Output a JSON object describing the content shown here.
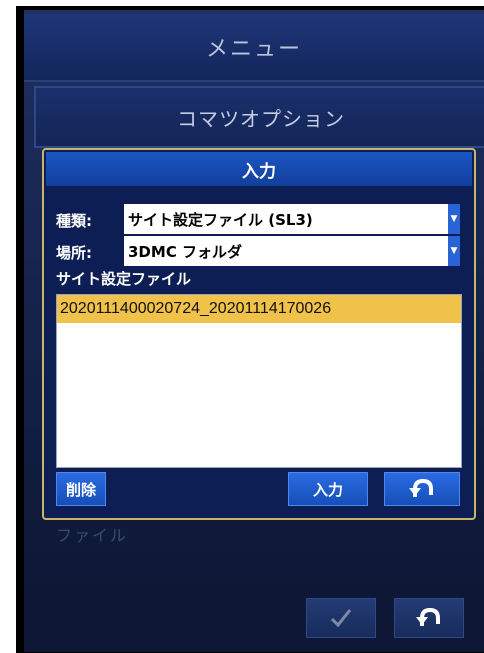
{
  "header": {
    "menu_title": "メニュー",
    "options_title": "コマツオプション"
  },
  "background": {
    "faded_text": "ファイル"
  },
  "dialog": {
    "title": "入力",
    "type_label": "種類:",
    "type_value": "サイト設定ファイル (SL3)",
    "location_label": "場所:",
    "location_value": "3DMC フォルダ",
    "list_label": "サイト設定ファイル",
    "files": [
      "2020111400020724_20201114170026"
    ],
    "selected_index": 0,
    "delete_label": "削除",
    "enter_label": "入力",
    "back_icon": "undo-icon"
  },
  "footer": {
    "confirm_icon": "check-icon",
    "back_icon": "undo-icon"
  },
  "colors": {
    "accent_blue": "#1c55c2",
    "selection": "#f1c24a",
    "dialog_border": "#c9b46a"
  }
}
